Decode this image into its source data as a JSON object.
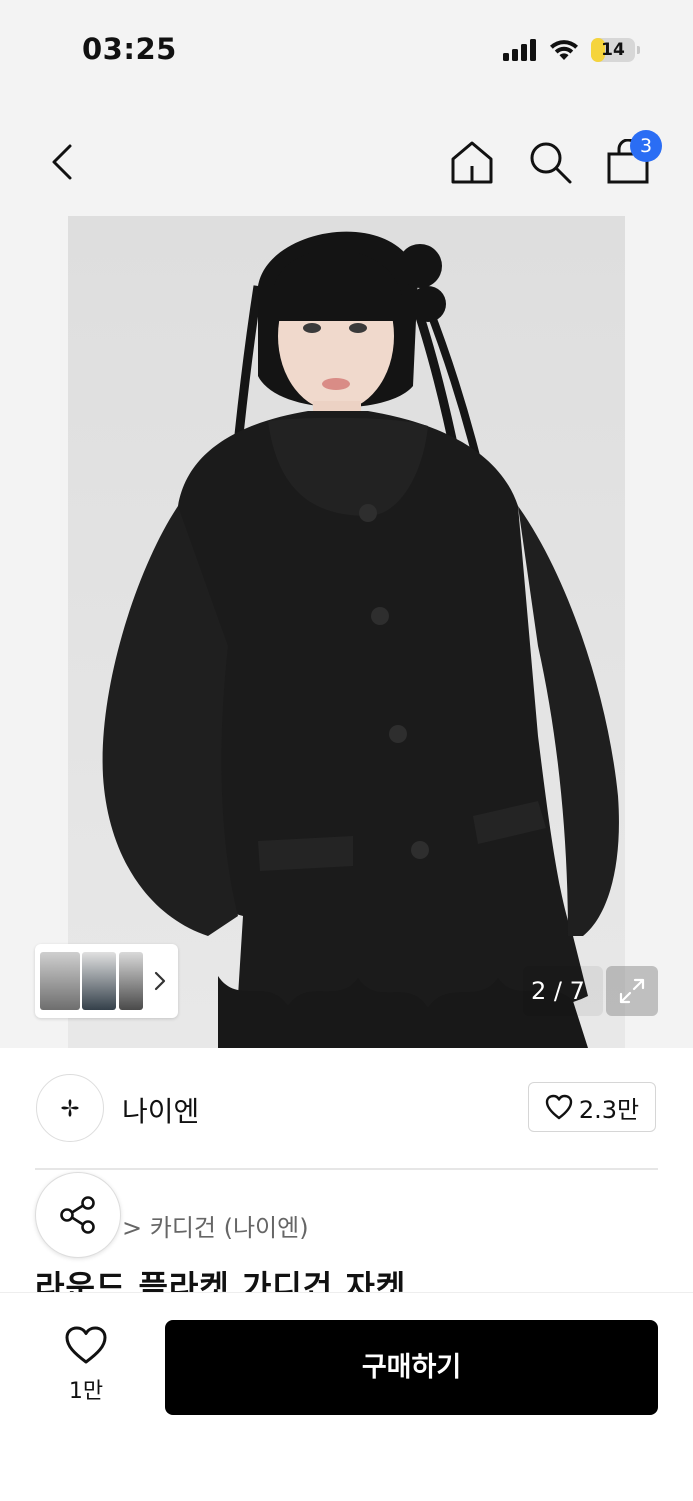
{
  "status_bar": {
    "time": "03:25",
    "battery": "14",
    "battery_level": 0.14,
    "icons": [
      "cellular-signal-icon",
      "wifi-icon",
      "battery-icon"
    ]
  },
  "nav": {
    "icons": [
      "back-arrow-icon",
      "home-icon",
      "search-icon",
      "shopping-bag-icon"
    ],
    "cart_badge": "3"
  },
  "gallery": {
    "counter": "2 / 7",
    "icons": [
      "chevron-right-icon",
      "expand-icon"
    ]
  },
  "brand": {
    "name": "나이엔",
    "likes": "2.3만",
    "icons": [
      "brand-logo-icon",
      "heart-icon"
    ]
  },
  "breadcrumb": "> 카디건 (나이엔)",
  "product": {
    "title": "라운드 플라켓 가디건 자켓"
  },
  "bottom_bar": {
    "wish_count": "1만",
    "buy_label": "구매하기",
    "icons": [
      "heart-icon"
    ]
  },
  "colors": {
    "accent_badge": "#2a6df4",
    "buy_button": "#000000",
    "battery_fill": "#f5d43c"
  }
}
